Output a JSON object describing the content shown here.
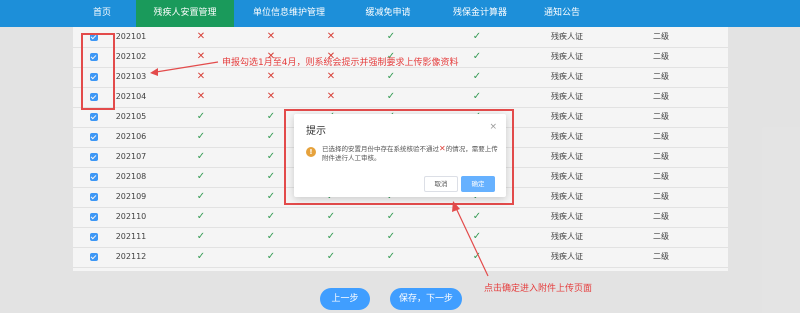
{
  "nav": {
    "items": [
      {
        "label": "首页"
      },
      {
        "label": "残疾人安置管理"
      },
      {
        "label": "单位信息维护管理"
      },
      {
        "label": "缓减免申请"
      },
      {
        "label": "残保金计算器"
      },
      {
        "label": "通知公告"
      }
    ]
  },
  "table": {
    "rows": [
      {
        "month": "202101",
        "c1": "x",
        "c2": "x",
        "c3": "x",
        "c4": "ok",
        "c5": "ok",
        "type": "残疾人证",
        "level": "二级"
      },
      {
        "month": "202102",
        "c1": "x",
        "c2": "x",
        "c3": "x",
        "c4": "ok",
        "c5": "ok",
        "type": "残疾人证",
        "level": "二级"
      },
      {
        "month": "202103",
        "c1": "x",
        "c2": "x",
        "c3": "x",
        "c4": "ok",
        "c5": "ok",
        "type": "残疾人证",
        "level": "二级"
      },
      {
        "month": "202104",
        "c1": "x",
        "c2": "x",
        "c3": "x",
        "c4": "ok",
        "c5": "ok",
        "type": "残疾人证",
        "level": "二级"
      },
      {
        "month": "202105",
        "c1": "ok",
        "c2": "ok",
        "c3": "ok",
        "c4": "ok",
        "c5": "ok",
        "type": "残疾人证",
        "level": "二级"
      },
      {
        "month": "202106",
        "c1": "ok",
        "c2": "ok",
        "c3": "ok",
        "c4": "ok",
        "c5": "ok",
        "type": "残疾人证",
        "level": "二级"
      },
      {
        "month": "202107",
        "c1": "ok",
        "c2": "ok",
        "c3": "ok",
        "c4": "ok",
        "c5": "ok",
        "type": "残疾人证",
        "level": "二级"
      },
      {
        "month": "202108",
        "c1": "ok",
        "c2": "ok",
        "c3": "ok",
        "c4": "ok",
        "c5": "ok",
        "type": "残疾人证",
        "level": "二级"
      },
      {
        "month": "202109",
        "c1": "ok",
        "c2": "ok",
        "c3": "ok",
        "c4": "ok",
        "c5": "ok",
        "type": "残疾人证",
        "level": "二级"
      },
      {
        "month": "202110",
        "c1": "ok",
        "c2": "ok",
        "c3": "ok",
        "c4": "ok",
        "c5": "ok",
        "type": "残疾人证",
        "level": "二级"
      },
      {
        "month": "202111",
        "c1": "ok",
        "c2": "ok",
        "c3": "ok",
        "c4": "ok",
        "c5": "ok",
        "type": "残疾人证",
        "level": "二级"
      },
      {
        "month": "202112",
        "c1": "ok",
        "c2": "ok",
        "c3": "ok",
        "c4": "ok",
        "c5": "ok",
        "type": "残疾人证",
        "level": "二级"
      }
    ]
  },
  "annotations": {
    "top_note": "申报勾选1月至4月，则系统会提示并强制要求上传影像资料",
    "bottom_note": "点击确定进入附件上传页面"
  },
  "dialog": {
    "title": "提示",
    "close": "×",
    "warn": "!",
    "message_before": "已选择的安置月份中存在系统核验不通过",
    "message_mark": "✕",
    "message_after": "的情况，需要上传附件进行人工审核。",
    "cancel_label": "取消",
    "confirm_label": "确定"
  },
  "footer": {
    "prev_label": "上一步",
    "next_label": "保存，下一步"
  },
  "colors": {
    "nav": "#1d8fd9",
    "nav_active": "#1a9a5b",
    "primary": "#409eff",
    "annotation": "#e34b4b",
    "check": "#3aa35a",
    "cross": "#e0433b"
  }
}
